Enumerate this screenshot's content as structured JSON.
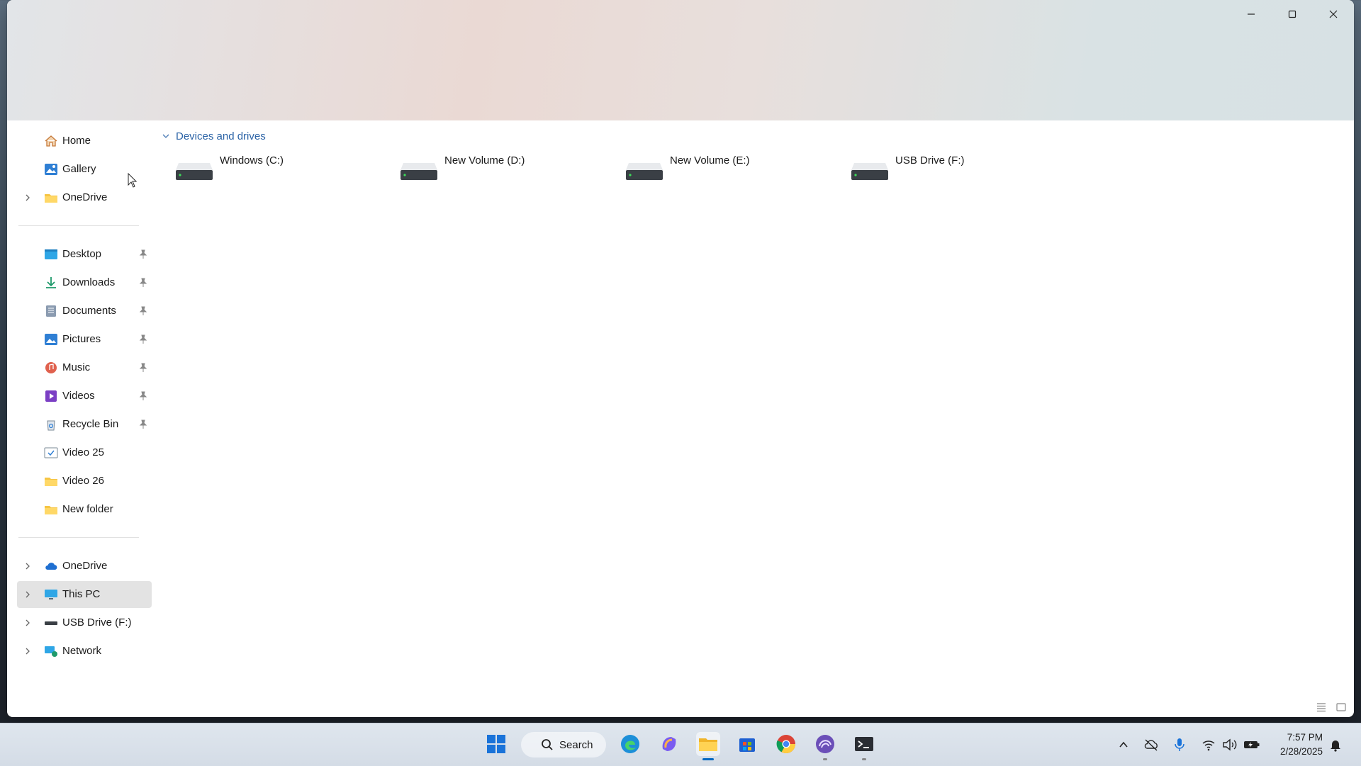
{
  "window": {
    "controls": {
      "minimize": "minimize",
      "maximize": "maximize",
      "close": "close"
    }
  },
  "sidebar": {
    "items": [
      {
        "label": "Home",
        "icon": "home-icon"
      },
      {
        "label": "Gallery",
        "icon": "gallery-icon"
      },
      {
        "label": "OneDrive",
        "icon": "folder-icon",
        "expandable": true
      },
      {
        "label": "Desktop",
        "icon": "desktop-icon",
        "pinned": true
      },
      {
        "label": "Downloads",
        "icon": "download-icon",
        "pinned": true
      },
      {
        "label": "Documents",
        "icon": "documents-icon",
        "pinned": true
      },
      {
        "label": "Pictures",
        "icon": "pictures-icon",
        "pinned": true
      },
      {
        "label": "Music",
        "icon": "music-icon",
        "pinned": true
      },
      {
        "label": "Videos",
        "icon": "videos-icon",
        "pinned": true
      },
      {
        "label": "Recycle Bin",
        "icon": "recycle-bin-icon",
        "pinned": true
      },
      {
        "label": "Video 25",
        "icon": "folder-check-icon"
      },
      {
        "label": "Video 26",
        "icon": "folder-icon"
      },
      {
        "label": "New folder",
        "icon": "folder-icon"
      },
      {
        "label": "OneDrive",
        "icon": "cloud-icon",
        "expandable": true
      },
      {
        "label": "This PC",
        "icon": "computer-icon",
        "expandable": true,
        "selected": true
      },
      {
        "label": "USB Drive (F:)",
        "icon": "usb-drive-icon",
        "expandable": true
      },
      {
        "label": "Network",
        "icon": "network-icon",
        "expandable": true
      }
    ]
  },
  "main": {
    "group_label": "Devices and drives",
    "drives": [
      {
        "name": "Windows (C:)"
      },
      {
        "name": "New Volume (D:)"
      },
      {
        "name": "New Volume (E:)"
      },
      {
        "name": "USB Drive (F:)"
      }
    ]
  },
  "taskbar": {
    "search_label": "Search",
    "apps": [
      "start-icon",
      "edge-icon",
      "copilot-icon",
      "file-explorer-icon",
      "store-icon",
      "chrome-icon",
      "app-icon",
      "terminal-icon"
    ],
    "time": "7:57 PM",
    "date": "2/28/2025"
  },
  "colors": {
    "accent": "#0067c0",
    "group_header": "#2b63a6",
    "selected_bg": "#e3e3e3"
  }
}
